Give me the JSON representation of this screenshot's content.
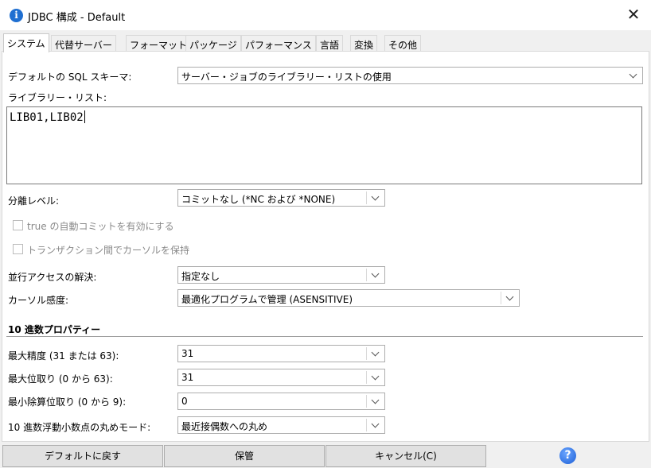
{
  "window": {
    "title": "JDBC 構成 - Default",
    "close_glyph": "✕",
    "app_icon_letter": "i"
  },
  "tabs": [
    {
      "label": "システム",
      "active": true
    },
    {
      "label": "代替サーバー"
    },
    {
      "label": "フォーマット"
    },
    {
      "label": "パッケージ"
    },
    {
      "label": "パフォーマンス"
    },
    {
      "label": "言語"
    },
    {
      "label": "変換"
    },
    {
      "label": "その他"
    }
  ],
  "system": {
    "default_schema_label": "デフォルトの SQL スキーマ:",
    "default_schema_value": "サーバー・ジョブのライブラリー・リストの使用",
    "library_list_label": "ライブラリー・リスト:",
    "library_list_value": "LIB01,LIB02",
    "isolation_label": "分離レベル:",
    "isolation_value": "コミットなし (*NC および *NONE)",
    "autocommit_label": "true の自動コミットを有効にする",
    "hold_cursor_label": "トランザクション間でカーソルを保持",
    "concurrent_label": "並行アクセスの解決:",
    "concurrent_value": "指定なし",
    "cursor_sensitivity_label": "カーソル感度:",
    "cursor_sensitivity_value": "最適化プログラムで管理 (ASENSITIVE)"
  },
  "decimal": {
    "section_title": "10 進数プロパティー",
    "max_precision_label": "最大精度 (31 または 63):",
    "max_precision_value": "31",
    "max_scale_label": "最大位取り (0 から 63):",
    "max_scale_value": "31",
    "min_divide_scale_label": "最小除算位取り (0 から 9):",
    "min_divide_scale_value": "0",
    "rounding_mode_label": "10 進数浮動小数点の丸めモード:",
    "rounding_mode_value": "最近接偶数への丸め"
  },
  "footer": {
    "restore_defaults": "デフォルトに戻す",
    "save": "保管",
    "cancel": "キャンセル(C)",
    "help_glyph": "?"
  },
  "icons": {
    "app": "info-app-icon",
    "close": "close-icon",
    "dropdown": "chevron-down-icon",
    "help": "help-icon"
  }
}
